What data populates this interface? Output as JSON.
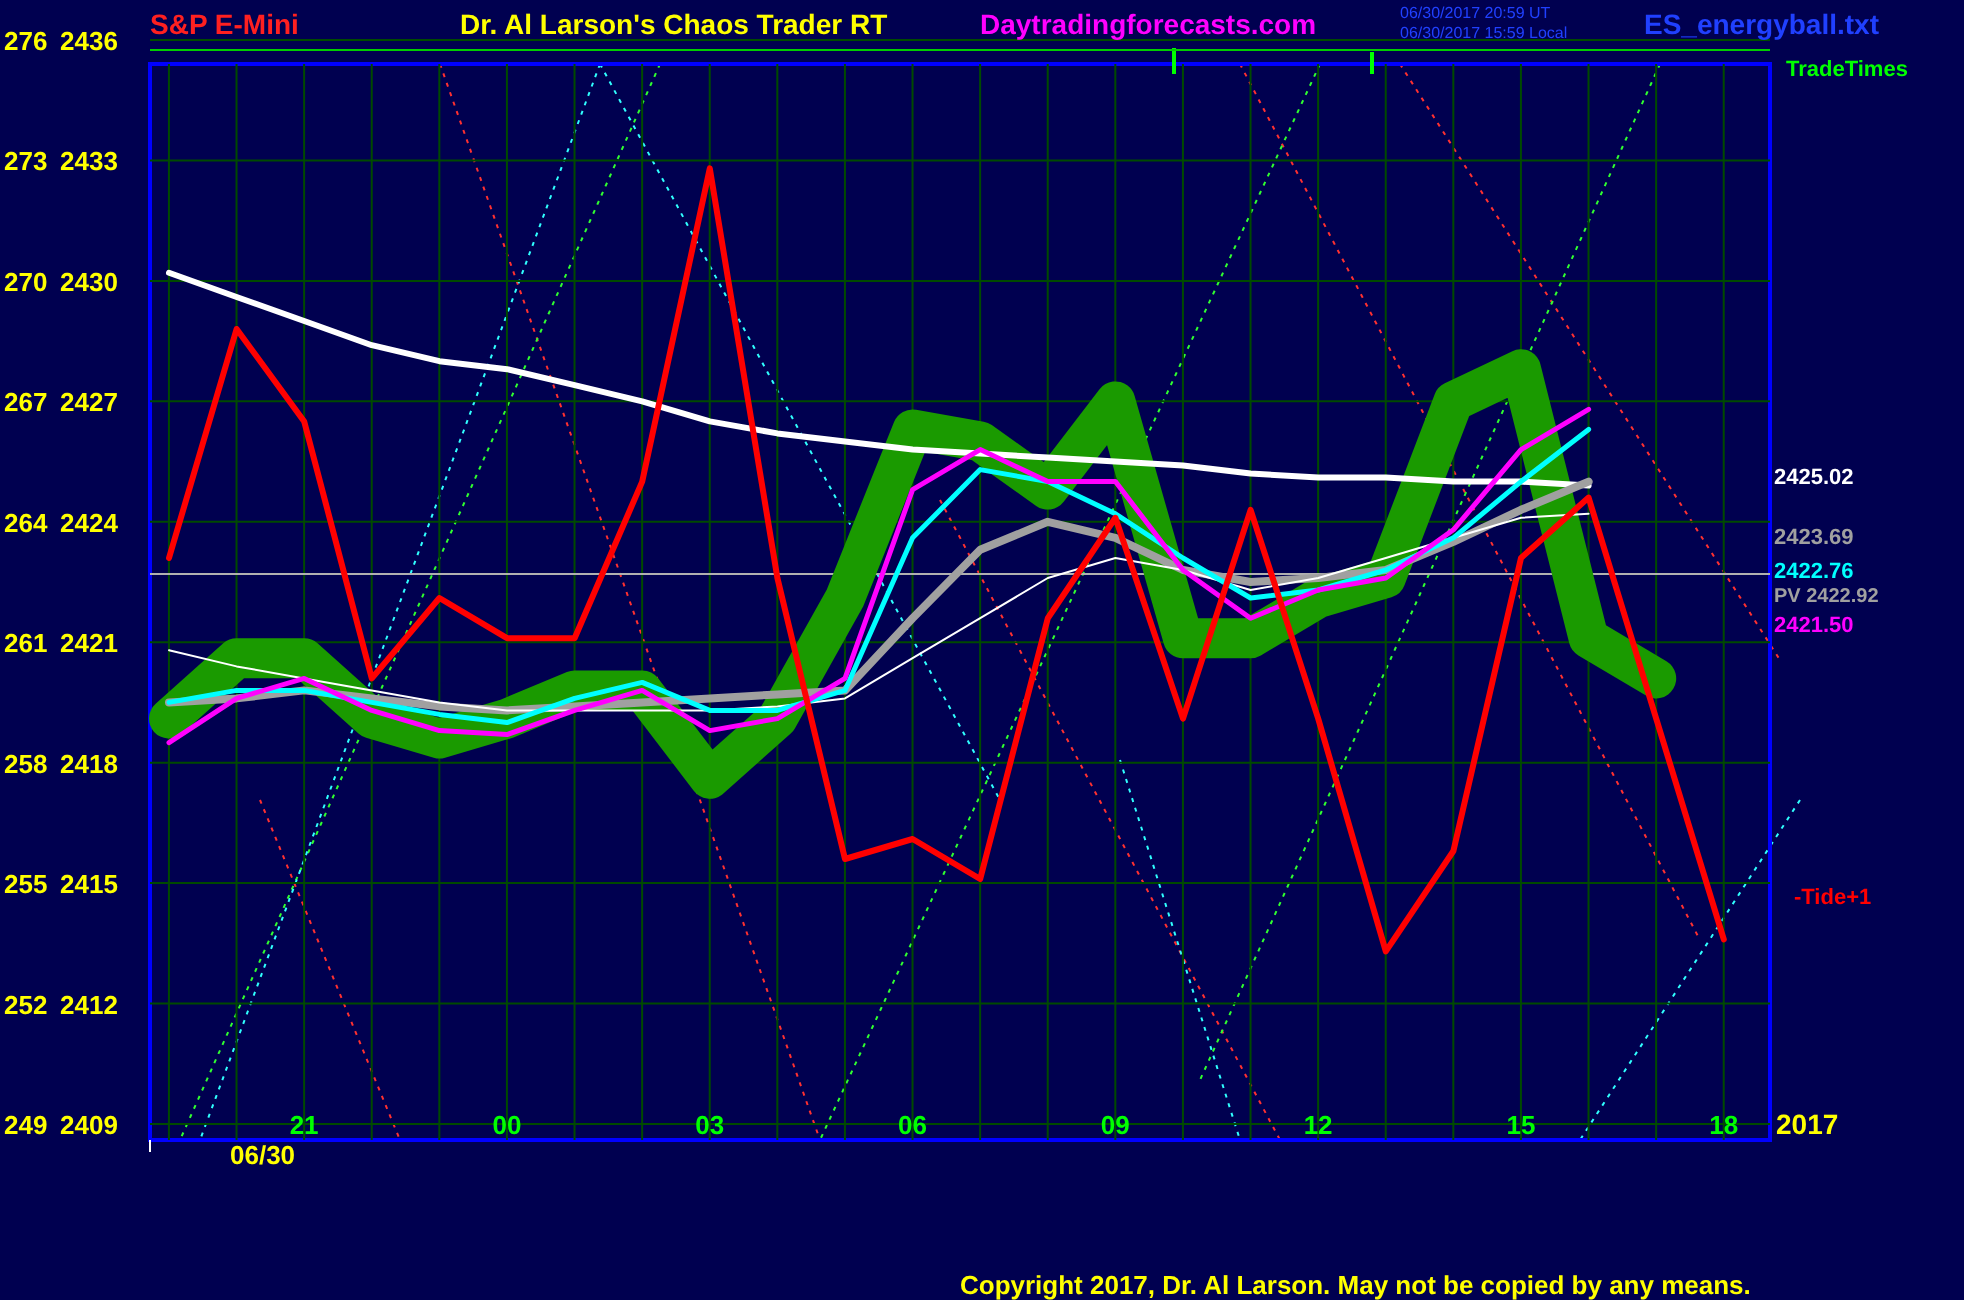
{
  "header": {
    "symbol": "S&P E-Mini",
    "title": "Dr. Al Larson's Chaos Trader RT",
    "website": "Daytradingforecasts.com",
    "time_ut": "06/30/2017 20:59 UT",
    "time_local": "06/30/2017 15:59 Local",
    "file": "ES_energyball.txt"
  },
  "trade_times": {
    "label": "TradeTimes"
  },
  "chart_data": {
    "type": "line",
    "categories": [
      null,
      null,
      "21",
      null,
      null,
      "00",
      null,
      null,
      "03",
      null,
      null,
      "06",
      null,
      null,
      "09",
      null,
      null,
      "12",
      null,
      null,
      "15",
      null,
      null,
      "18"
    ],
    "ylim": [
      2409,
      2436
    ],
    "yticks": [
      2436,
      2433,
      2430,
      2427,
      2424,
      2421,
      2418,
      2415,
      2412,
      2409
    ],
    "grid": true,
    "ref_lines": [
      {
        "axis": "y",
        "value": 2435.75,
        "color": "#00cc00"
      },
      {
        "axis": "y",
        "value": 2422.7,
        "color": "#b0b0b0"
      }
    ],
    "series": [
      {
        "color": "#1a9a00",
        "values": [
          2419.1,
          2420.6,
          2420.6,
          2419.1,
          2418.6,
          2419.1,
          2419.8,
          2419.8,
          2417.6,
          2419.1,
          2422.1,
          2426.3,
          2426.0,
          2424.8,
          2427.0,
          2421.1,
          2421.1,
          2422.1,
          2422.6,
          2427.0,
          2427.8,
          2421.1,
          2420.1,
          null
        ]
      },
      {
        "color": "#ffffff",
        "values": [
          2430.2,
          2429.6,
          2429.0,
          2428.4,
          2428.0,
          2427.8,
          2427.4,
          2427.0,
          2426.5,
          2426.2,
          2426.0,
          2425.8,
          2425.7,
          2425.6,
          2425.5,
          2425.4,
          2425.2,
          2425.1,
          2425.1,
          2425.0,
          2425.0,
          2424.9,
          null,
          null
        ]
      },
      {
        "color": "#a0a0a0",
        "values": [
          2419.5,
          2419.6,
          2419.8,
          2419.6,
          2419.4,
          2419.3,
          2419.4,
          2419.5,
          2419.6,
          2419.7,
          2419.8,
          2421.6,
          2423.3,
          2424.0,
          2423.6,
          2422.8,
          2422.5,
          2422.6,
          2422.8,
          2423.5,
          2424.3,
          2425.0,
          null,
          null
        ]
      },
      {
        "color": "#ffffff",
        "values": [
          2420.8,
          2420.4,
          2420.1,
          2419.8,
          2419.5,
          2419.3,
          2419.3,
          2419.3,
          2419.3,
          2419.4,
          2419.6,
          2420.6,
          2421.6,
          2422.6,
          2423.1,
          2422.8,
          2422.3,
          2422.6,
          2423.1,
          2423.6,
          2424.1,
          2424.2,
          null,
          null
        ]
      },
      {
        "color": "#00ffff",
        "values": [
          2419.5,
          2419.8,
          2419.8,
          2419.5,
          2419.2,
          2419.0,
          2419.6,
          2420.0,
          2419.3,
          2419.3,
          2419.8,
          2423.6,
          2425.3,
          2425.0,
          2424.2,
          2423.1,
          2422.1,
          2422.3,
          2422.8,
          2423.6,
          2425.0,
          2426.3,
          null,
          null
        ]
      },
      {
        "color": "#ff00ff",
        "values": [
          2418.5,
          2419.6,
          2420.1,
          2419.3,
          2418.8,
          2418.7,
          2419.3,
          2419.8,
          2418.8,
          2419.1,
          2420.1,
          2424.8,
          2425.8,
          2425.0,
          2425.0,
          2422.8,
          2421.6,
          2422.3,
          2422.6,
          2423.8,
          2425.8,
          2426.8,
          null,
          null
        ]
      },
      {
        "color": "#ff0000",
        "values": [
          2423.1,
          2428.8,
          2426.5,
          2420.1,
          2422.1,
          2421.1,
          2421.1,
          2425.0,
          2432.8,
          2422.6,
          2415.6,
          2416.1,
          2415.1,
          2421.6,
          2424.1,
          2419.1,
          2424.3,
          2419.1,
          2413.3,
          2415.8,
          2423.1,
          2424.6,
          2419.1,
          2413.6
        ]
      }
    ]
  },
  "series_styles": [
    {
      "kind": "band"
    },
    {
      "kind": "thick"
    },
    {
      "kind": "heavy"
    },
    {
      "kind": "thin"
    },
    {
      "kind": "medium"
    },
    {
      "kind": "medium"
    },
    {
      "kind": "thick"
    }
  ],
  "left_scale": [
    "276",
    "273",
    "270",
    "267",
    "264",
    "261",
    "258",
    "255",
    "252",
    "249"
  ],
  "date_label": "06/30",
  "year_label": "2017",
  "last_values": [
    {
      "text": "2425.02",
      "color": "#ffffff"
    },
    {
      "text": "2423.69",
      "color": "#a0a0a0"
    },
    {
      "text": "2422.76",
      "color": "#00ffff"
    },
    {
      "text": "PV 2422.92",
      "color": "#a0a0a0"
    },
    {
      "text": "2421.50",
      "color": "#ff00ff"
    },
    {
      "text": "-Tide+1",
      "color": "#ff0000"
    }
  ],
  "copyright": "Copyright 2017, Dr. Al Larson. May not be copied by any means."
}
